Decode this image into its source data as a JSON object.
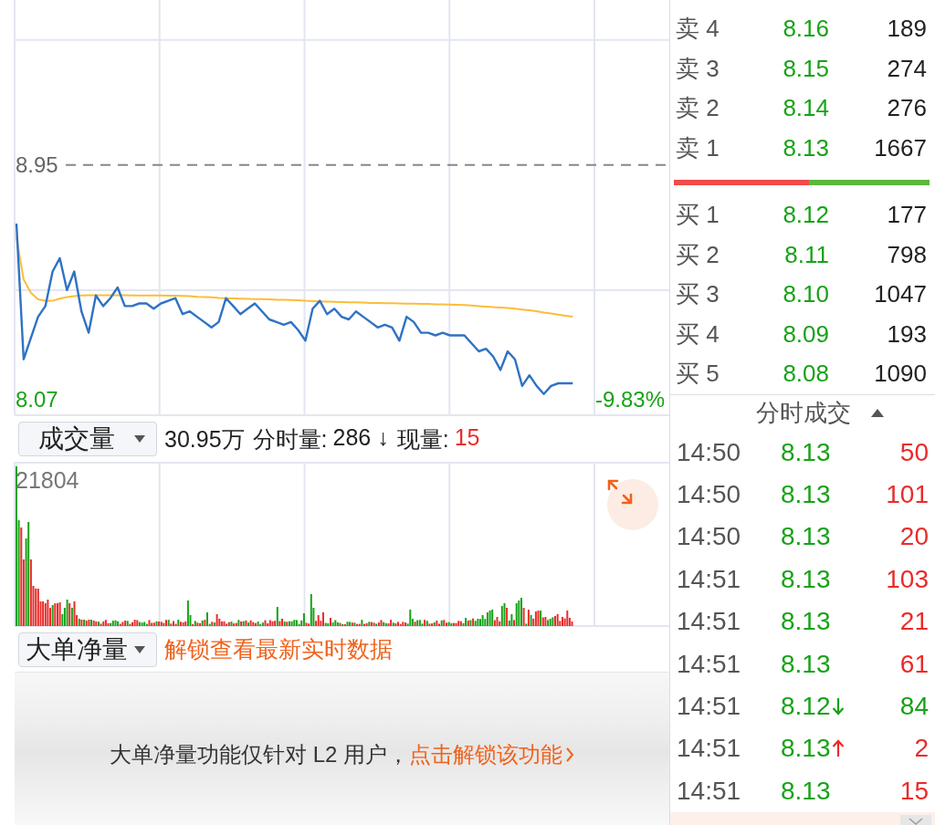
{
  "price_chart": {
    "chart_data": {
      "type": "line",
      "categories": [
        null,
        null,
        null,
        null,
        null,
        null,
        null,
        null,
        null,
        null,
        null,
        null,
        null,
        null,
        null,
        null,
        null,
        null,
        null,
        null,
        null,
        null,
        null,
        null,
        null,
        null,
        null,
        null,
        null,
        null,
        null,
        null,
        null,
        null,
        null,
        null,
        null,
        null,
        null,
        null,
        null,
        null,
        null,
        null,
        null,
        null,
        null,
        null,
        null,
        null,
        null,
        null,
        null,
        null,
        null,
        null,
        null,
        null,
        null,
        null,
        null,
        null,
        null,
        null,
        null,
        null,
        null,
        null,
        null,
        null,
        null,
        null,
        null,
        null,
        null,
        null,
        null,
        null,
        null,
        null,
        null
      ],
      "ylim": [
        8.01,
        9.57
      ],
      "yticks": [
        {
          "value": 8.95,
          "label": "8.95"
        },
        {
          "value": 8.07,
          "label": "8.07"
        }
      ],
      "grid": true,
      "series": [
        {
          "color": "#2f72c4",
          "values": [
            8.73,
            8.22,
            8.3,
            8.38,
            8.42,
            8.55,
            8.6,
            8.48,
            8.55,
            8.4,
            8.32,
            8.46,
            8.42,
            8.45,
            8.49,
            8.42,
            8.42,
            8.43,
            8.43,
            8.41,
            8.43,
            8.44,
            8.45,
            8.39,
            8.4,
            8.38,
            8.36,
            8.34,
            8.36,
            8.45,
            8.42,
            8.39,
            8.41,
            8.43,
            8.4,
            8.37,
            8.36,
            8.35,
            8.36,
            8.33,
            8.29,
            8.41,
            8.44,
            8.39,
            8.41,
            8.38,
            8.37,
            8.4,
            8.38,
            8.36,
            8.34,
            8.35,
            8.34,
            8.29,
            8.38,
            8.36,
            8.32,
            8.32,
            8.31,
            8.32,
            8.31,
            8.31,
            8.31,
            8.28,
            8.25,
            8.26,
            8.23,
            8.18,
            8.25,
            8.22,
            8.12,
            8.16,
            8.12,
            8.09,
            8.12,
            8.13,
            8.13,
            8.13,
            null,
            null,
            null
          ]
        },
        {
          "color": "#fbbd3a",
          "values": [
            8.68,
            8.52,
            8.47,
            8.445,
            8.44,
            8.44,
            8.448,
            8.454,
            8.457,
            8.46,
            8.461,
            8.461,
            8.461,
            8.461,
            8.461,
            8.461,
            8.46,
            8.46,
            8.46,
            8.46,
            8.46,
            8.459,
            8.459,
            8.458,
            8.457,
            8.455,
            8.454,
            8.453,
            8.451,
            8.45,
            8.449,
            8.448,
            8.447,
            8.446,
            8.446,
            8.445,
            8.444,
            8.444,
            8.443,
            8.442,
            8.44,
            8.439,
            8.438,
            8.437,
            8.436,
            8.435,
            8.434,
            8.434,
            8.433,
            8.432,
            8.432,
            8.431,
            8.431,
            8.43,
            8.429,
            8.429,
            8.428,
            8.428,
            8.427,
            8.427,
            8.426,
            8.425,
            8.424,
            8.422,
            8.42,
            8.418,
            8.416,
            8.415,
            8.413,
            8.41,
            8.407,
            8.404,
            8.401,
            8.396,
            8.392,
            8.388,
            8.384,
            8.38,
            null,
            null,
            null
          ]
        }
      ],
      "ref_lines": [
        {
          "axis": "y",
          "value": 8.95
        }
      ],
      "annotations": [
        "-9.83%"
      ]
    }
  },
  "volume_panel": {
    "selector": {
      "label": "成交量"
    },
    "total": "30.95万",
    "stats": [
      {
        "label": "分时量:",
        "value": "286 ↓",
        "rising": false
      },
      {
        "label": "现量:",
        "value": "15",
        "rising": true
      }
    ],
    "max_label": "21804"
  },
  "big_order_panel": {
    "selector": {
      "label": "大单净量"
    },
    "unlock_hint": "解锁查看最新实时数据",
    "locked_message": {
      "text": "大单净量功能仅针对 L2 用户，",
      "link": "点击解锁该功能"
    }
  },
  "order_book": {
    "asks": [
      {
        "label": "卖 4",
        "price": "8.16",
        "volume": "189",
        "falling": true
      },
      {
        "label": "卖 3",
        "price": "8.15",
        "volume": "274",
        "falling": true
      },
      {
        "label": "卖 2",
        "price": "8.14",
        "volume": "276",
        "falling": true
      },
      {
        "label": "卖 1",
        "price": "8.13",
        "volume": "1667",
        "falling": true
      }
    ],
    "strength_bar": {
      "level": 0.53
    },
    "bids": [
      {
        "label": "买 1",
        "price": "8.12",
        "volume": "177",
        "falling": true
      },
      {
        "label": "买 2",
        "price": "8.11",
        "volume": "798",
        "falling": true
      },
      {
        "label": "买 3",
        "price": "8.10",
        "volume": "1047",
        "falling": true
      },
      {
        "label": "买 4",
        "price": "8.09",
        "volume": "193",
        "falling": true
      },
      {
        "label": "买 5",
        "price": "8.08",
        "volume": "1090",
        "falling": true
      }
    ]
  },
  "trades": {
    "title": "分时成交",
    "rows": [
      {
        "time": "14:50",
        "price": "8.13",
        "falling": true,
        "tick_up": false,
        "tick_down": false,
        "volume": "50",
        "buy": true
      },
      {
        "time": "14:50",
        "price": "8.13",
        "falling": true,
        "tick_up": false,
        "tick_down": false,
        "volume": "101",
        "buy": true
      },
      {
        "time": "14:50",
        "price": "8.13",
        "falling": true,
        "tick_up": false,
        "tick_down": false,
        "volume": "20",
        "buy": true
      },
      {
        "time": "14:51",
        "price": "8.13",
        "falling": true,
        "tick_up": false,
        "tick_down": false,
        "volume": "103",
        "buy": true
      },
      {
        "time": "14:51",
        "price": "8.13",
        "falling": true,
        "tick_up": false,
        "tick_down": false,
        "volume": "21",
        "buy": true
      },
      {
        "time": "14:51",
        "price": "8.13",
        "falling": true,
        "tick_up": false,
        "tick_down": false,
        "volume": "61",
        "buy": true
      },
      {
        "time": "14:51",
        "price": "8.12",
        "falling": true,
        "tick_up": false,
        "tick_down": true,
        "volume": "84",
        "buy": false
      },
      {
        "time": "14:51",
        "price": "8.13",
        "falling": true,
        "tick_up": true,
        "tick_down": false,
        "volume": "2",
        "buy": true
      },
      {
        "time": "14:51",
        "price": "8.13",
        "falling": true,
        "tick_up": false,
        "tick_down": false,
        "volume": "15",
        "buy": true
      }
    ]
  }
}
